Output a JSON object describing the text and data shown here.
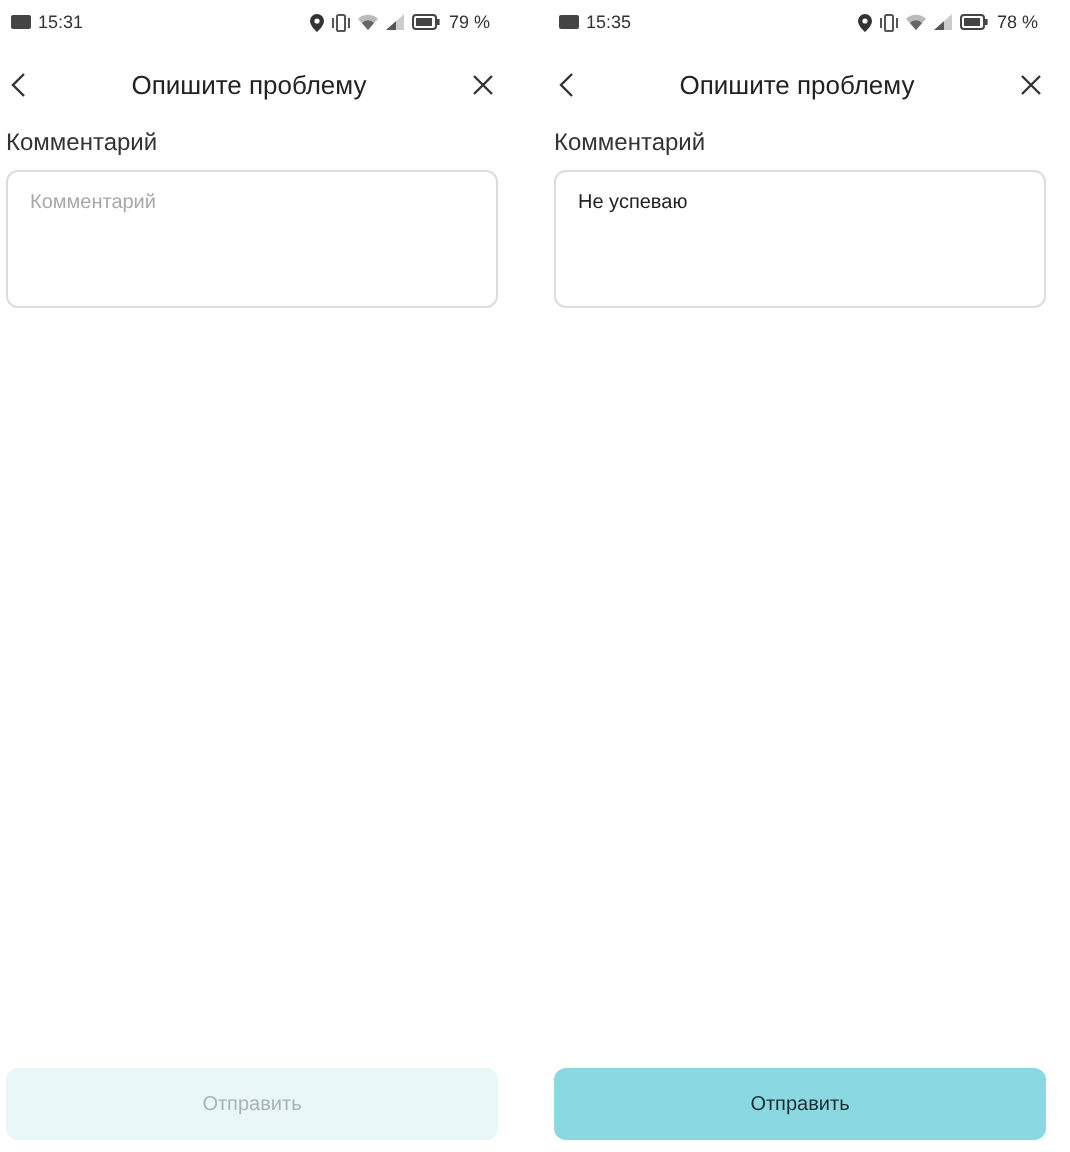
{
  "screens": [
    {
      "status_bar": {
        "time": "15:31",
        "battery": "79 %"
      },
      "header": {
        "title": "Опишите проблему"
      },
      "comment": {
        "label": "Комментарий",
        "placeholder": "Комментарий"
      },
      "submit": {
        "label": "Отправить",
        "disabled": true
      }
    },
    {
      "status_bar": {
        "time": "15:35",
        "battery": "78 %"
      },
      "header": {
        "title": "Опишите проблему"
      },
      "comment": {
        "label": "Комментарий",
        "value": "Не успеваю"
      },
      "submit": {
        "label": "Отправить",
        "disabled": false
      }
    }
  ]
}
